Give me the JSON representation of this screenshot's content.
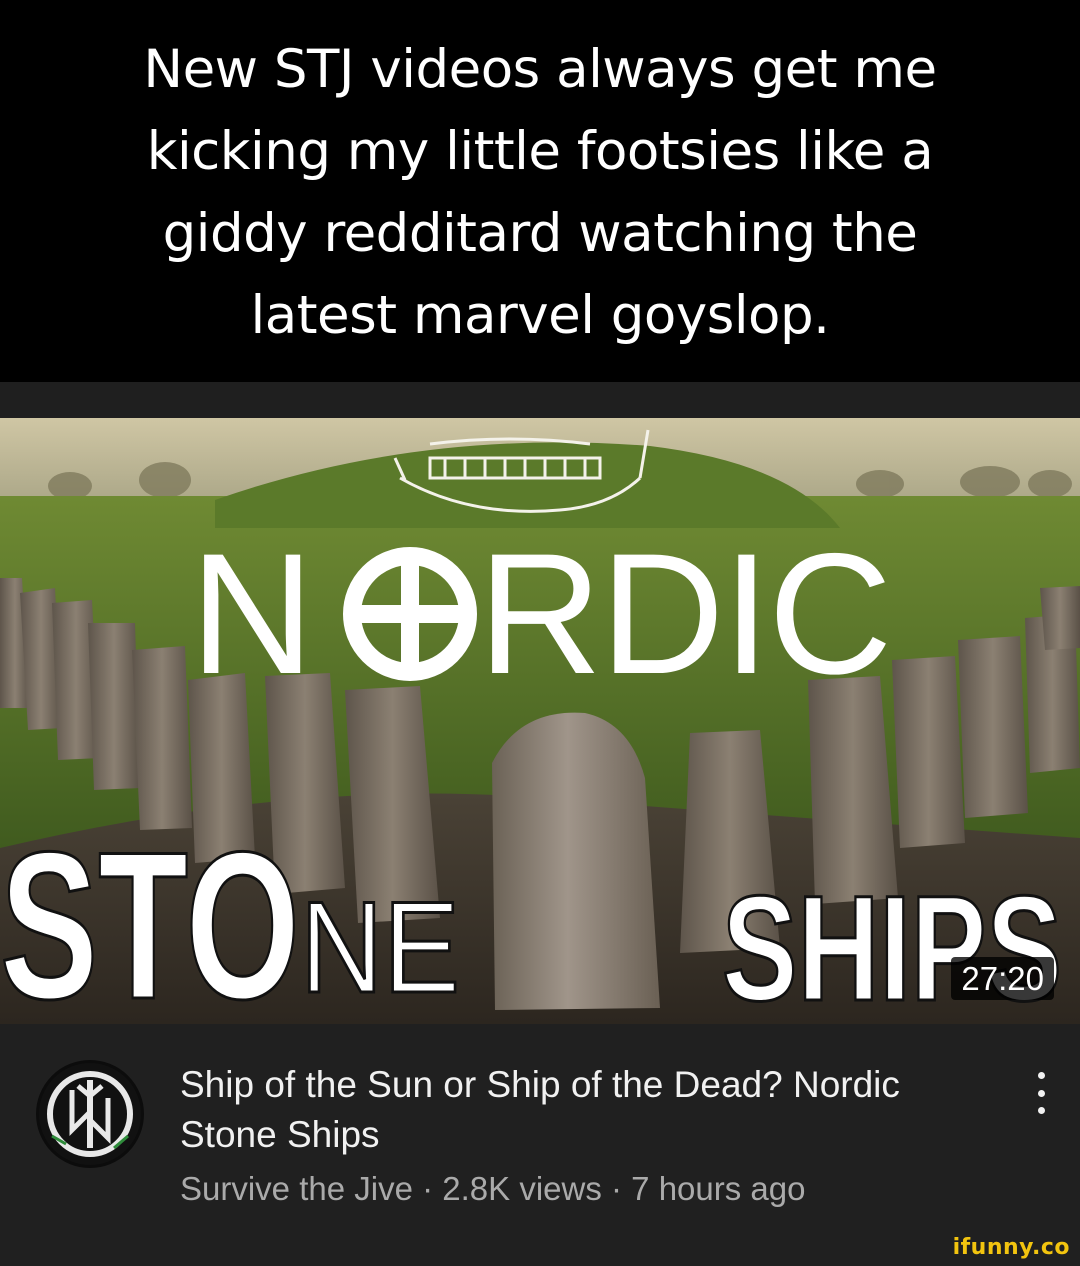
{
  "caption": {
    "lines": [
      "New STJ videos always get me",
      "kicking my little footsies like a",
      "giddy redditard watching the",
      "latest marvel goyslop."
    ]
  },
  "thumbnail": {
    "title_word_1": "NORDIC",
    "title_word_2a": "STONE",
    "title_word_2b": "SHIPS",
    "duration": "27:20"
  },
  "video": {
    "title": "Ship of the Sun or Ship of the Dead? Nordic Stone Ships",
    "channel": "Survive the Jive",
    "views": "2.8K views",
    "age": "7 hours ago",
    "separator": " · "
  },
  "icons": {
    "more": "more-vert-icon",
    "avatar": "channel-avatar-rune-icon"
  },
  "watermark": "ifunny.co",
  "colors": {
    "caption_bg": "#000000",
    "panel_bg": "#202020",
    "title_text": "#f1f1f1",
    "meta_text": "#aaaaaa",
    "watermark": "#f2c40f"
  }
}
